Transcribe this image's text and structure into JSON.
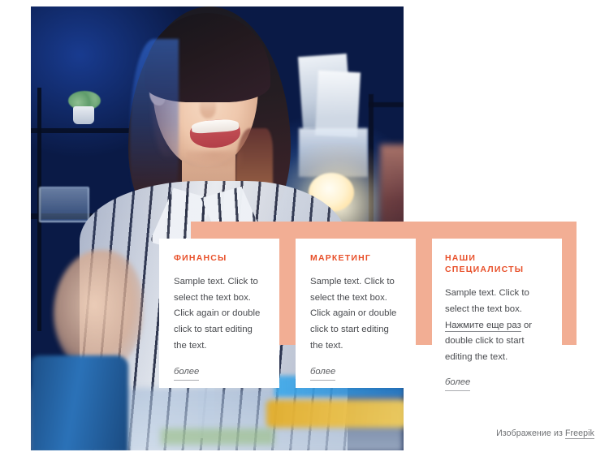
{
  "page": {
    "background_color": "#ffffff",
    "accent_peach": "#f2ae94",
    "accent_orange": "#e8502a",
    "body_text_color": "#494b4f"
  },
  "hero": {
    "alt": "smiling-woman-in-striped-shirt-at-blue-lit-office-desk",
    "photo_name": "hero-photo"
  },
  "cards": [
    {
      "title": "ФИНАНСЫ",
      "body_before_link": "Sample text. Click to select the text box. Click again or double click to start editing the text.",
      "link_text": "",
      "body_after_link": "",
      "more_label": "более"
    },
    {
      "title": "МАРКЕТИНГ",
      "body_before_link": "Sample text. Click to select the text box. Click again or double click to start editing the text.",
      "link_text": "",
      "body_after_link": "",
      "more_label": "более"
    },
    {
      "title": "НАШИ СПЕЦИАЛИСТЫ",
      "body_before_link": "Sample text. Click to select the text box. ",
      "link_text": "Нажмите еще раз",
      "body_after_link": " or double click to start editing the text.",
      "more_label": "более"
    }
  ],
  "credit": {
    "prefix": "Изображение из ",
    "link_label": "Freepik"
  }
}
